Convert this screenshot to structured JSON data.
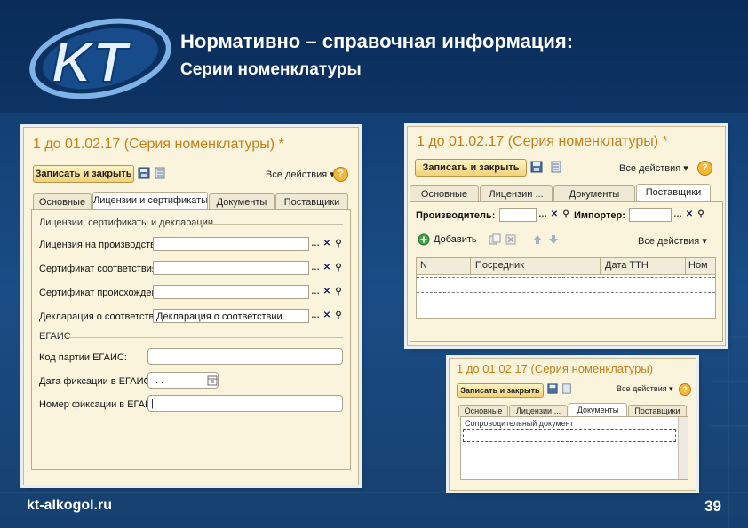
{
  "slide": {
    "title": "Нормативно – справочная информация:",
    "subtitle": "Серии номенклатуры",
    "site": "kt-alkogol.ru",
    "page_number": "39",
    "logo_text": "KT"
  },
  "window_main": {
    "title": "1 до 01.02.17 (Серия номенклатуры) *",
    "save_close": "Записать и закрыть",
    "all_actions": "Все действия ▾",
    "help": "?",
    "tabs": [
      "Основные",
      "Лицензии и сертификаты",
      "Документы",
      "Поставщики"
    ],
    "group_licenses": "Лицензии, сертификаты и декларации",
    "fields": [
      {
        "label": "Лицензия на производство:",
        "value": ""
      },
      {
        "label": "Сертификат соответствия:",
        "value": ""
      },
      {
        "label": "Сертификат происхождения:",
        "value": ""
      },
      {
        "label": "Декларация о соответствии:",
        "value": "Декларация о соответствии"
      }
    ],
    "group_egais": "ЕГАИС",
    "egais_fields": [
      {
        "label": "Код партии ЕГАИС:",
        "value": ""
      },
      {
        "label": "Дата фиксации в ЕГАИС:",
        "value": ". ."
      },
      {
        "label": "Номер фиксации в ЕГАИС:",
        "value": "|"
      }
    ]
  },
  "window_suppliers": {
    "title": "1 до 01.02.17 (Серия номенклатуры) *",
    "save_close": "Записать и закрыть",
    "all_actions": "Все действия ▾",
    "help": "?",
    "tabs": [
      "Основные",
      "Лицензии ...",
      "Документы",
      "Поставщики"
    ],
    "producer_label": "Производитель:",
    "importer_label": "Импортер:",
    "add_label": "Добавить",
    "all_actions_grid": "Все действия ▾",
    "columns": [
      "N",
      "Посредник",
      "Дата ТТН",
      "Ном"
    ]
  },
  "window_docs": {
    "title": "1 до 01.02.17 (Серия номенклатуры)",
    "save_close": "Записать и закрыть",
    "all_actions": "Все действия ▾",
    "help": "?",
    "tabs": [
      "Основные",
      "Лицензии ...",
      "Документы",
      "Поставщики"
    ],
    "row_text": "Сопроводительный документ"
  },
  "colors": {
    "background": "#123f74",
    "window_bg": "#fbf4dc",
    "title_orange": "#c47f18",
    "button_gold": "#f2d27a"
  }
}
